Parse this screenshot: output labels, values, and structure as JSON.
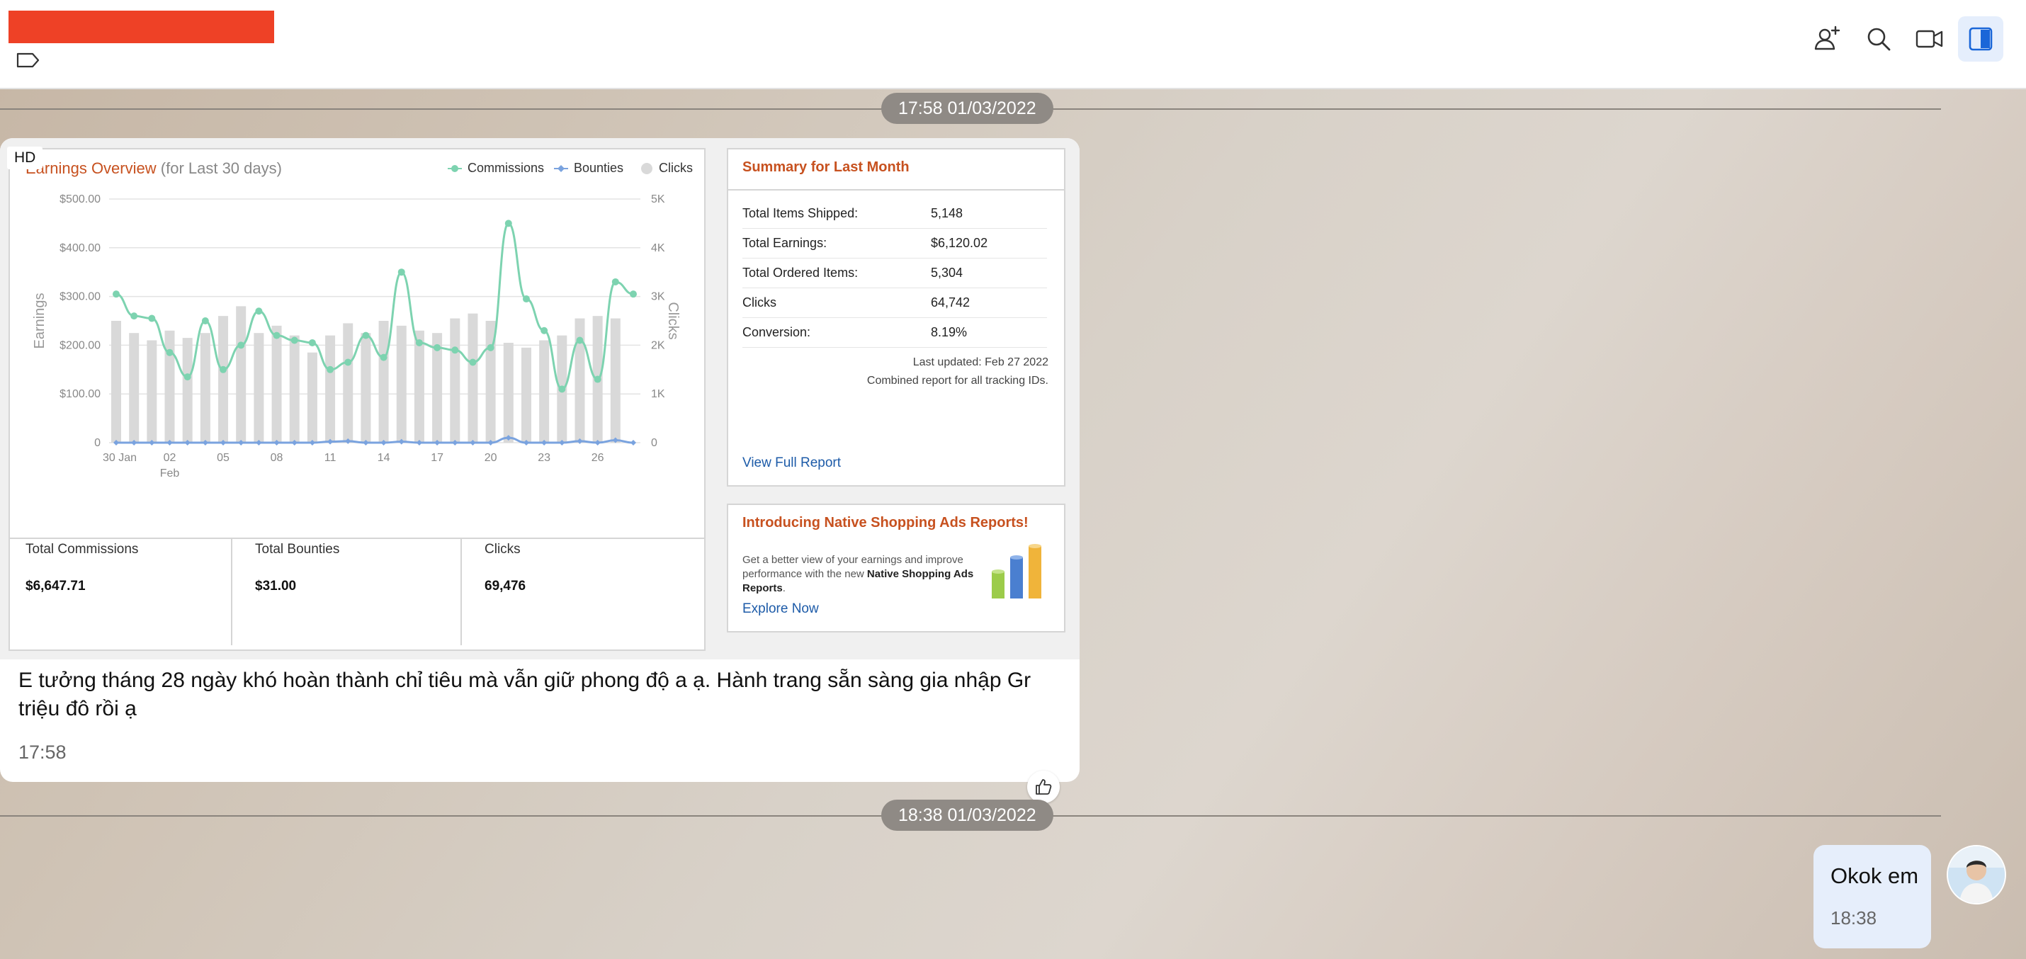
{
  "header": {
    "icons": [
      "add-member-icon",
      "search-icon",
      "video-call-icon",
      "sidebar-toggle-icon"
    ]
  },
  "dividers": [
    {
      "time": "17:58 01/03/2022"
    },
    {
      "time": "18:38 01/03/2022"
    }
  ],
  "incoming_message": {
    "hd_badge": "HD",
    "text": "E tưởng tháng 28 ngày khó hoàn thành chỉ tiêu mà vẫn giữ phong độ a ạ. Hành trang sẵn sàng gia nhập Gr triệu đô rồi ạ",
    "time": "17:58"
  },
  "earnings": {
    "title": "Earnings Overview",
    "subtitle": "(for Last 30 days)",
    "legend": {
      "commissions": "Commissions",
      "bounties": "Bounties",
      "clicks": "Clicks"
    },
    "totals": [
      {
        "label": "Total Commissions",
        "value": "$6,647.71"
      },
      {
        "label": "Total Bounties",
        "value": "$31.00"
      },
      {
        "label": "Clicks",
        "value": "69,476"
      }
    ]
  },
  "chart_data": {
    "type": "bar",
    "title": "Earnings Overview",
    "subtitle": "(for Last 30 days)",
    "ylabel": "Earnings",
    "y2label": "Clicks",
    "ylim": [
      0,
      500
    ],
    "y2lim": [
      0,
      5000
    ],
    "y_ticks": [
      "$500.00",
      "$400.00",
      "$300.00",
      "$200.00",
      "$100.00",
      "0"
    ],
    "y2_ticks": [
      "5K",
      "4K",
      "3K",
      "2K",
      "1K",
      "0"
    ],
    "x_ticks": [
      "30 Jan",
      "02",
      "05",
      "08",
      "11",
      "14",
      "17",
      "20",
      "23",
      "26"
    ],
    "x_sublabel": "Feb",
    "legend_position": "top-right",
    "grid": true,
    "series": [
      {
        "name": "Clicks",
        "kind": "bar",
        "axis": "right",
        "color": "#d9d9d9",
        "values": [
          2500,
          2250,
          2100,
          2300,
          2150,
          2250,
          2600,
          2800,
          2250,
          2400,
          2200,
          1850,
          2200,
          2450,
          2250,
          2500,
          2400,
          2300,
          2250,
          2550,
          2650,
          2500,
          2050,
          1950,
          2100,
          2200,
          2550,
          2600,
          2550
        ]
      },
      {
        "name": "Commissions",
        "kind": "line",
        "axis": "left",
        "color": "#7dd3b0",
        "values": [
          305,
          260,
          255,
          185,
          135,
          250,
          150,
          200,
          270,
          220,
          210,
          205,
          150,
          165,
          220,
          175,
          350,
          205,
          195,
          190,
          165,
          195,
          450,
          295,
          230,
          110,
          210,
          130,
          330,
          305
        ]
      },
      {
        "name": "Bounties",
        "kind": "line",
        "axis": "left",
        "color": "#7aa3df",
        "values": [
          0,
          0,
          0,
          0,
          0,
          0,
          0,
          0,
          0,
          0,
          0,
          0,
          2,
          3,
          0,
          0,
          2,
          0,
          0,
          0,
          0,
          0,
          10,
          0,
          0,
          0,
          3,
          0,
          5,
          0
        ]
      }
    ]
  },
  "summary": {
    "title": "Summary for Last Month",
    "rows": [
      {
        "label": "Total Items Shipped:",
        "value": "5,148"
      },
      {
        "label": "Total Earnings:",
        "value": "$6,120.02"
      },
      {
        "label": "Total Ordered Items:",
        "value": "5,304"
      },
      {
        "label": "Clicks",
        "value": "64,742"
      },
      {
        "label": "Conversion:",
        "value": "8.19%"
      }
    ],
    "last_updated": "Last updated: Feb 27 2022",
    "note": "Combined report for all tracking IDs.",
    "link": "View Full Report"
  },
  "promo": {
    "title": "Introducing Native Shopping Ads Reports!",
    "text_a": "Get a better view of your earnings and improve performance with the new ",
    "text_bold": "Native Shopping Ads Reports",
    "text_b": ".",
    "link": "Explore Now"
  },
  "outgoing_message": {
    "text": "Okok em",
    "time": "18:38"
  },
  "colors": {
    "accent_orange": "#c7511f",
    "link_blue": "#1d5ba8",
    "redaction": "#ee4126",
    "bubble_out": "#e6eefb"
  }
}
